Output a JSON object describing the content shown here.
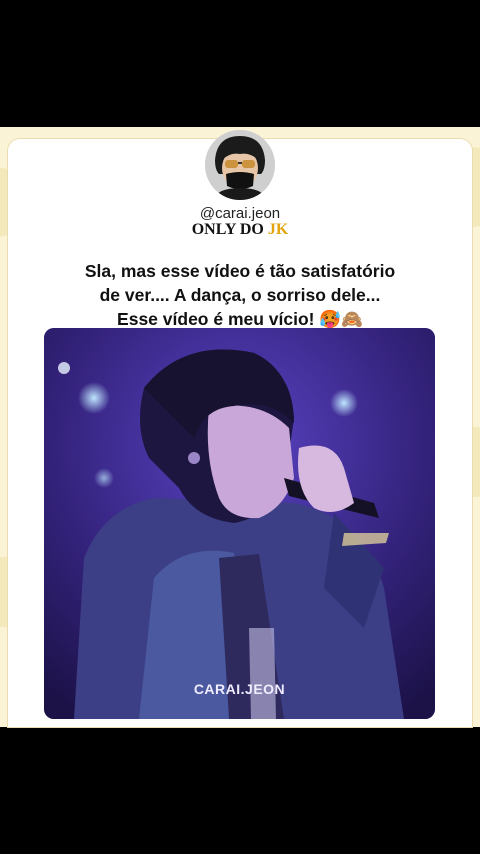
{
  "profile": {
    "handle": "@carai.jeon",
    "tagline_prefix": "ONLY DO ",
    "tagline_highlight": "JK"
  },
  "post": {
    "line1": "Sla, mas esse vídeo é tão satisfatório",
    "line2": "de ver.... A dança, o sorriso dele...",
    "line3": "Esse vídeo é meu vício! 🥵🙈"
  },
  "video": {
    "watermark": "CARAI.JEON"
  },
  "colors": {
    "background_band": "#fbf3d6",
    "tagline_highlight": "#e3a40d",
    "video_tint": "#3b2a8c"
  }
}
